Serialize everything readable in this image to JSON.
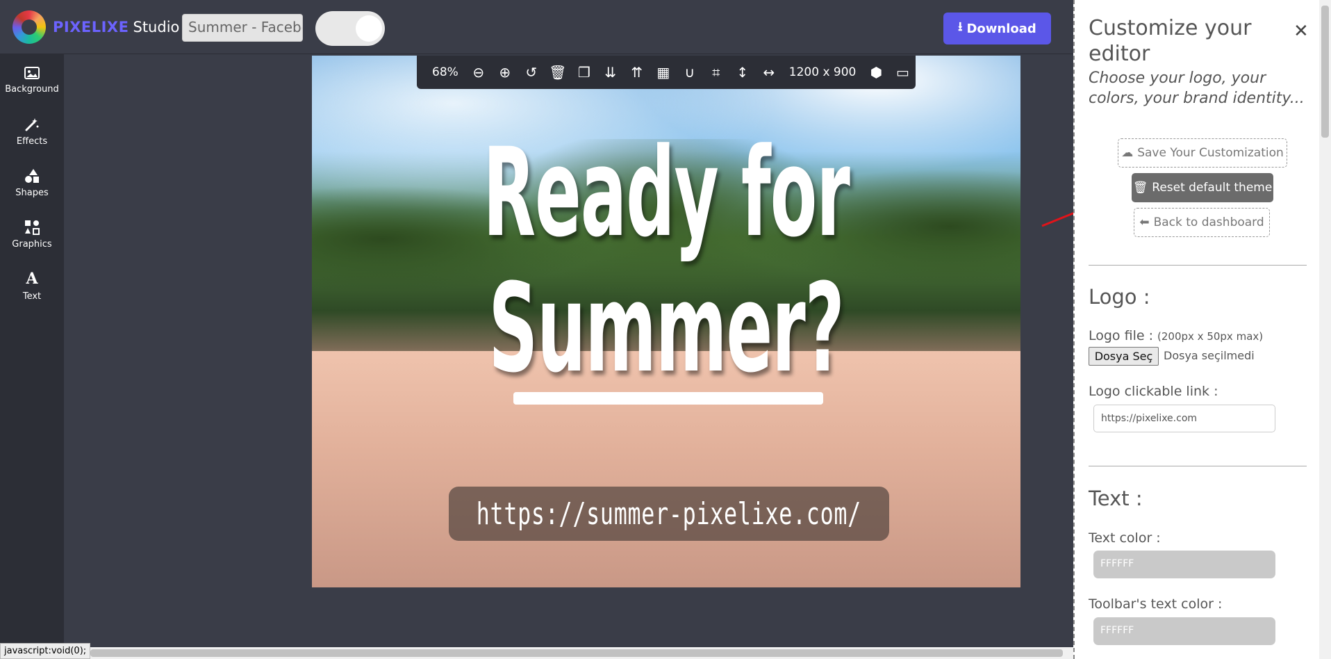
{
  "app": {
    "brand_name": "PIXELIXE",
    "brand_suffix": "Studio",
    "document_title": "Summer - Facebook",
    "download_label": "Download"
  },
  "sidebar": {
    "items": [
      {
        "label": "Background",
        "icon": "image-icon"
      },
      {
        "label": "Effects",
        "icon": "magic-wand-icon"
      },
      {
        "label": "Shapes",
        "icon": "shapes-icon"
      },
      {
        "label": "Graphics",
        "icon": "graphics-icon"
      },
      {
        "label": "Text",
        "icon": "text-icon"
      }
    ]
  },
  "toolbar": {
    "zoom": "68%",
    "dimensions": "1200 x 900",
    "icons": [
      "zoom-out-icon",
      "zoom-in-icon",
      "undo-icon",
      "trash-icon",
      "duplicate-icon",
      "move-down-icon",
      "move-up-icon",
      "grid-icon",
      "magnet-icon",
      "crop-icon",
      "resize-height-icon",
      "resize-width-icon",
      "cube-icon",
      "desktop-icon"
    ]
  },
  "canvas": {
    "headline_line1": "Ready for",
    "headline_line2": "Summer?",
    "url": "https://summer-pixelixe.com/"
  },
  "panel": {
    "title": "Customize your editor",
    "subtitle": "Choose your logo, your colors, your brand identity...",
    "save_label": "Save Your Customization",
    "reset_label": "Reset default theme",
    "back_label": "Back to dashboard",
    "logo_section": "Logo :",
    "logo_file_label": "Logo file :",
    "logo_file_hint": "(200px x 50px max)",
    "file_button": "Dosya Seç",
    "file_none": "Dosya seçilmedi",
    "logo_link_label": "Logo clickable link :",
    "logo_link_value": "https://pixelixe.com",
    "text_section": "Text :",
    "text_color_label": "Text color :",
    "text_color_value": "FFFFFF",
    "toolbar_text_color_label": "Toolbar's text color :",
    "toolbar_text_color_value": "FFFFFF"
  },
  "status_bar": {
    "text": "javascript:void(0);"
  },
  "colors": {
    "accent": "#5b57e8",
    "sidebar_bg": "#2c2e36",
    "workspace_bg": "#3a3d48",
    "arrow": "#e0141a"
  }
}
